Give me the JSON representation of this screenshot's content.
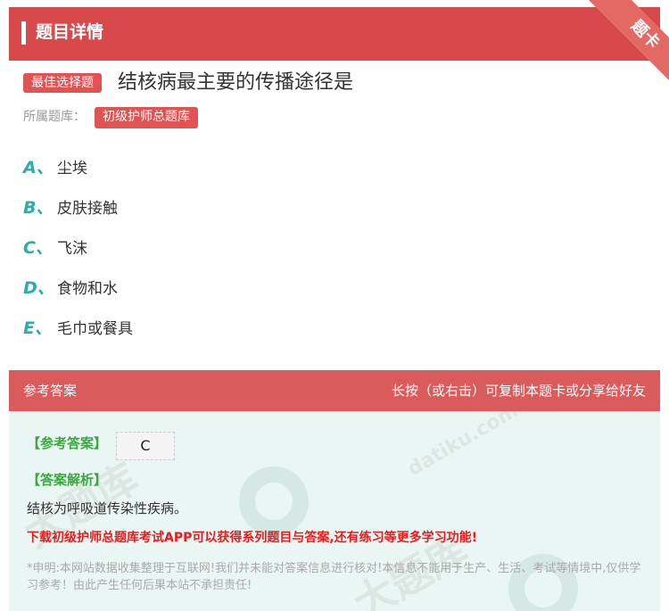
{
  "header": {
    "title": "题目详情",
    "ribbon": "题卡"
  },
  "question": {
    "type_tag": "最佳选择题",
    "text": "结核病最主要的传播途径是",
    "bank_label": "所属题库：",
    "bank_name": "初级护师总题库"
  },
  "options": [
    {
      "letter": "A、",
      "text": "尘埃"
    },
    {
      "letter": "B、",
      "text": "皮肤接触"
    },
    {
      "letter": "C、",
      "text": "飞沫"
    },
    {
      "letter": "D、",
      "text": "食物和水"
    },
    {
      "letter": "E、",
      "text": "毛巾或餐具"
    }
  ],
  "answer": {
    "header_left": "参考答案",
    "header_right": "长按（或右击）可复制本题卡或分享给好友",
    "ref_label": "【参考答案】",
    "ref_value": "C",
    "analysis_label": "【答案解析】",
    "analysis": "结核为呼吸道传染性疾病。",
    "promo": "下载初级护师总题库考试APP可以获得系列题目与答案,还有练习等更多学习功能!",
    "disclaimer": "*申明:本网站数据收集整理于互联网!我们并未能对答案信息进行核对!本信息不能用于生产、生活、考试等情境中,仅供学习参考！由此产生任何后果本站不承担责任!"
  },
  "watermark": {
    "brand": "大题库",
    "domain": "datiku.com"
  },
  "colors": {
    "header_red": "#d8494c",
    "tag_red": "#e05353",
    "option_teal": "#2aaea6",
    "answer_green": "#3aa83e",
    "promo_red": "#e41e1e",
    "answer_bg": "#eaf6f3"
  }
}
